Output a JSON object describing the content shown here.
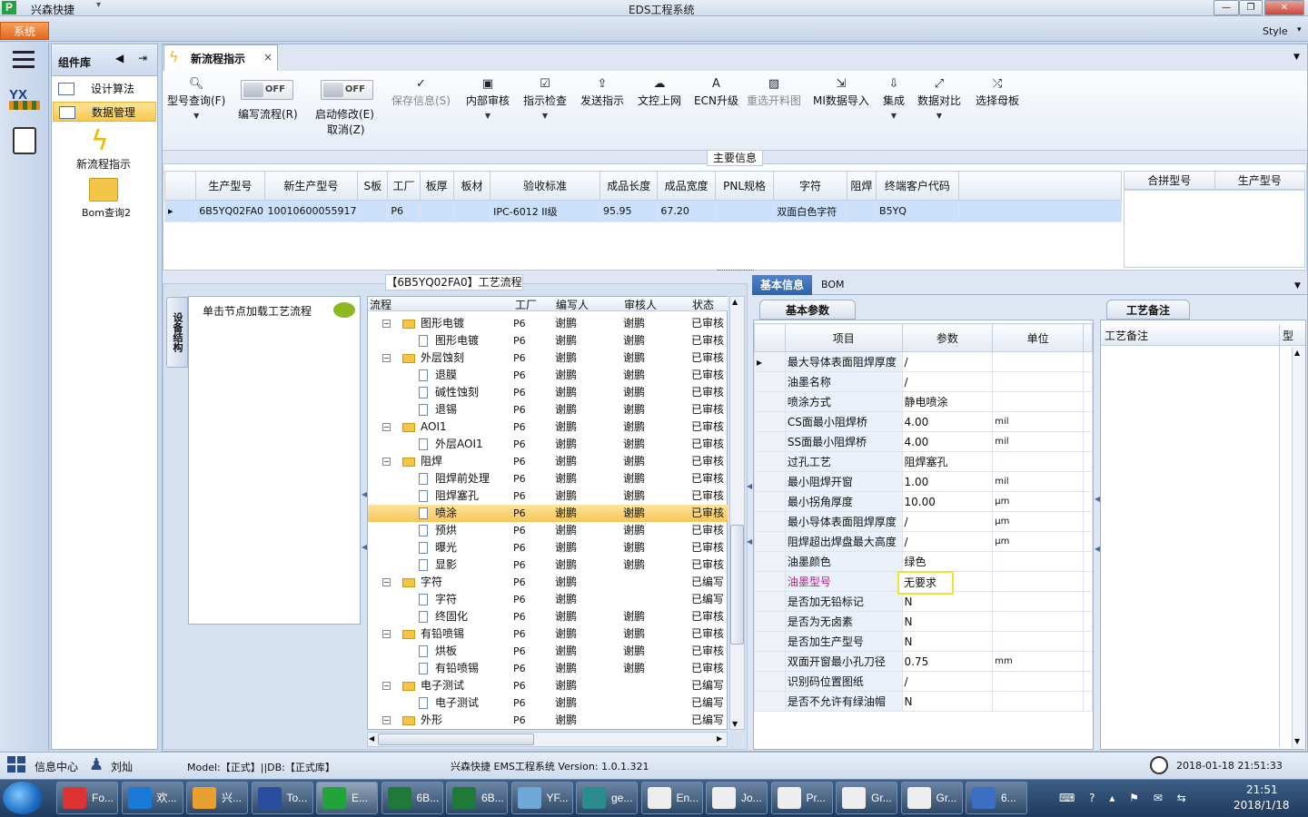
{
  "window": {
    "app_name": "兴森快捷",
    "title": "EDS工程系统",
    "min": "—",
    "max": "❐",
    "close": "✕"
  },
  "ribbon": {
    "system_tab": "系统",
    "style": "Style"
  },
  "component_panel": {
    "title": "组件库",
    "items": [
      {
        "label": "设计算法"
      },
      {
        "label": "数据管理"
      }
    ],
    "new_flow": "新流程指示",
    "bom": "Bom查询2"
  },
  "doc_tab": {
    "label": "新流程指示",
    "close": "×"
  },
  "toolbar": {
    "model_query": "型号查询(F)",
    "toggle1": {
      "state": "OFF",
      "label": "编写流程(R)"
    },
    "toggle2": {
      "state": "OFF",
      "label": "启动修改(E)",
      "sub": "取消(Z)"
    },
    "save": "保存信息(S)",
    "internal_review": "内部审核",
    "check": "指示检查",
    "send": "发送指示",
    "upload": "文控上网",
    "ecn": "ECN升级",
    "reselect": "重选开料图",
    "mi_import": "MI数据导入",
    "integrate": "集成",
    "compare": "数据对比",
    "mother_board": "选择母板"
  },
  "main_info": {
    "title": "主要信息",
    "columns": [
      "生产型号",
      "新生产型号",
      "S板",
      "工厂",
      "板厚",
      "板材",
      "验收标准",
      "成品长度",
      "成品宽度",
      "PNL规格",
      "字符",
      "阻焊",
      "终端客户代码"
    ],
    "row": [
      "6B5YQ02FA0",
      "10010600055917",
      "",
      "P6",
      "",
      "",
      "IPC-6012 II级",
      "95.95",
      "67.20",
      "",
      "双面白色字符",
      "",
      "B5YQ"
    ],
    "side_columns": [
      "合拼型号",
      "生产型号"
    ]
  },
  "process": {
    "title": "【6B5YQ02FA0】工艺流程",
    "side_tab": "设备结构",
    "hint": "单击节点加载工艺流程",
    "columns": [
      "流程",
      "工厂",
      "编写人",
      "审核人",
      "状态"
    ],
    "rows": [
      {
        "name": "图形电镀",
        "level": 1,
        "factory": "P6",
        "writer": "谢鹏",
        "reviewer": "谢鹏",
        "status": "已审核"
      },
      {
        "name": "图形电镀",
        "level": 2,
        "factory": "P6",
        "writer": "谢鹏",
        "reviewer": "谢鹏",
        "status": "已审核"
      },
      {
        "name": "外层蚀刻",
        "level": 1,
        "factory": "P6",
        "writer": "谢鹏",
        "reviewer": "谢鹏",
        "status": "已审核"
      },
      {
        "name": "退膜",
        "level": 2,
        "factory": "P6",
        "writer": "谢鹏",
        "reviewer": "谢鹏",
        "status": "已审核"
      },
      {
        "name": "碱性蚀刻",
        "level": 2,
        "factory": "P6",
        "writer": "谢鹏",
        "reviewer": "谢鹏",
        "status": "已审核"
      },
      {
        "name": "退锡",
        "level": 2,
        "factory": "P6",
        "writer": "谢鹏",
        "reviewer": "谢鹏",
        "status": "已审核"
      },
      {
        "name": "AOI1",
        "level": 1,
        "factory": "P6",
        "writer": "谢鹏",
        "reviewer": "谢鹏",
        "status": "已审核"
      },
      {
        "name": "外层AOI1",
        "level": 2,
        "factory": "P6",
        "writer": "谢鹏",
        "reviewer": "谢鹏",
        "status": "已审核"
      },
      {
        "name": "阻焊",
        "level": 1,
        "factory": "P6",
        "writer": "谢鹏",
        "reviewer": "谢鹏",
        "status": "已审核"
      },
      {
        "name": "阻焊前处理",
        "level": 2,
        "factory": "P6",
        "writer": "谢鹏",
        "reviewer": "谢鹏",
        "status": "已审核"
      },
      {
        "name": "阻焊塞孔",
        "level": 2,
        "factory": "P6",
        "writer": "谢鹏",
        "reviewer": "谢鹏",
        "status": "已审核"
      },
      {
        "name": "喷涂",
        "level": 2,
        "factory": "P6",
        "writer": "谢鹏",
        "reviewer": "谢鹏",
        "status": "已审核",
        "selected": true
      },
      {
        "name": "预烘",
        "level": 2,
        "factory": "P6",
        "writer": "谢鹏",
        "reviewer": "谢鹏",
        "status": "已审核"
      },
      {
        "name": "曝光",
        "level": 2,
        "factory": "P6",
        "writer": "谢鹏",
        "reviewer": "谢鹏",
        "status": "已审核"
      },
      {
        "name": "显影",
        "level": 2,
        "factory": "P6",
        "writer": "谢鹏",
        "reviewer": "谢鹏",
        "status": "已审核"
      },
      {
        "name": "字符",
        "level": 1,
        "factory": "P6",
        "writer": "谢鹏",
        "reviewer": "",
        "status": "已编写"
      },
      {
        "name": "字符",
        "level": 2,
        "factory": "P6",
        "writer": "谢鹏",
        "reviewer": "",
        "status": "已编写"
      },
      {
        "name": "终固化",
        "level": 2,
        "factory": "P6",
        "writer": "谢鹏",
        "reviewer": "谢鹏",
        "status": "已审核"
      },
      {
        "name": "有铅喷锡",
        "level": 1,
        "factory": "P6",
        "writer": "谢鹏",
        "reviewer": "谢鹏",
        "status": "已审核"
      },
      {
        "name": "烘板",
        "level": 2,
        "factory": "P6",
        "writer": "谢鹏",
        "reviewer": "谢鹏",
        "status": "已审核"
      },
      {
        "name": "有铅喷锡",
        "level": 2,
        "factory": "P6",
        "writer": "谢鹏",
        "reviewer": "谢鹏",
        "status": "已审核"
      },
      {
        "name": "电子测试",
        "level": 1,
        "factory": "P6",
        "writer": "谢鹏",
        "reviewer": "",
        "status": "已编写"
      },
      {
        "name": "电子测试",
        "level": 2,
        "factory": "P6",
        "writer": "谢鹏",
        "reviewer": "",
        "status": "已编写"
      },
      {
        "name": "外形",
        "level": 1,
        "factory": "P6",
        "writer": "谢鹏",
        "reviewer": "",
        "status": "已编写"
      }
    ]
  },
  "info_tabs": {
    "basic": "基本信息",
    "bom": "BOM"
  },
  "params": {
    "title": "基本参数",
    "columns": [
      "项目",
      "参数",
      "单位"
    ],
    "rows": [
      {
        "item": "最大导体表面阻焊厚度",
        "value": "/",
        "unit": ""
      },
      {
        "item": "油墨名称",
        "value": "/",
        "unit": ""
      },
      {
        "item": "喷涂方式",
        "value": "静电喷涂",
        "unit": ""
      },
      {
        "item": "CS面最小阻焊桥",
        "value": "4.00",
        "unit": "mil"
      },
      {
        "item": "SS面最小阻焊桥",
        "value": "4.00",
        "unit": "mil"
      },
      {
        "item": "过孔工艺",
        "value": "阻焊塞孔",
        "unit": ""
      },
      {
        "item": "最小阻焊开窗",
        "value": "1.00",
        "unit": "mil"
      },
      {
        "item": "最小拐角厚度",
        "value": "10.00",
        "unit": "μm"
      },
      {
        "item": "最小导体表面阻焊厚度",
        "value": "/",
        "unit": "μm"
      },
      {
        "item": "阻焊超出焊盘最大高度",
        "value": "/",
        "unit": "μm"
      },
      {
        "item": "油墨颜色",
        "value": "绿色",
        "unit": ""
      },
      {
        "item": "油墨型号",
        "value": "无要求",
        "unit": "",
        "editing": true
      },
      {
        "item": "是否加无铅标记",
        "value": "N",
        "unit": ""
      },
      {
        "item": "是否为无卤素",
        "value": "N",
        "unit": ""
      },
      {
        "item": "是否加生产型号",
        "value": "N",
        "unit": ""
      },
      {
        "item": "双面开窗最小孔刀径",
        "value": "0.75",
        "unit": "mm"
      },
      {
        "item": "识别码位置图纸",
        "value": "/",
        "unit": ""
      },
      {
        "item": "是否不允许有绿油帽",
        "value": "N",
        "unit": ""
      }
    ]
  },
  "remarks": {
    "title": "工艺备注",
    "columns": [
      "工艺备注",
      "型"
    ]
  },
  "statusbar": {
    "info_center": "信息中心",
    "user": "刘灿",
    "model": "Model:【正式】||DB:【正式库】",
    "version": "兴森快捷 EMS工程系统 Version: 1.0.1.321",
    "datetime": "2018-01-18 21:51:33"
  },
  "taskbar": {
    "items": [
      {
        "label": "Fo..."
      },
      {
        "label": "欢..."
      },
      {
        "label": "兴..."
      },
      {
        "label": "To..."
      },
      {
        "label": "E..."
      },
      {
        "label": "6B..."
      },
      {
        "label": "6B..."
      },
      {
        "label": "YF..."
      },
      {
        "label": "ge..."
      },
      {
        "label": "En..."
      },
      {
        "label": "Jo..."
      },
      {
        "label": "Pr..."
      },
      {
        "label": "Gr..."
      },
      {
        "label": "Gr..."
      },
      {
        "label": "6..."
      }
    ],
    "time": "21:51",
    "date": "2018/1/18"
  }
}
